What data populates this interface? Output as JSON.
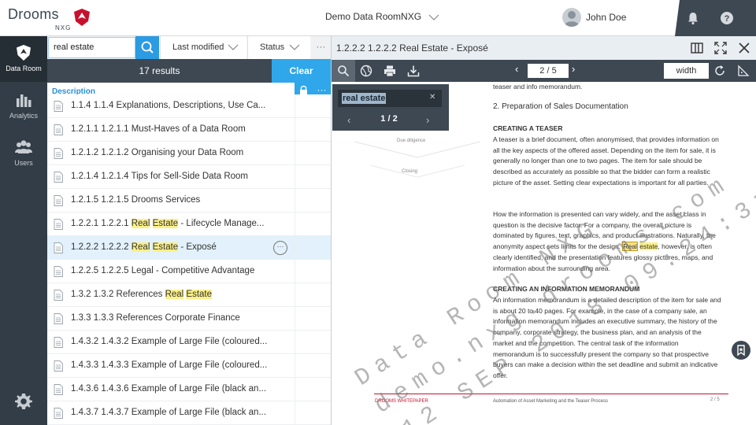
{
  "header": {
    "logo_text": "Drooms",
    "logo_sub": "NXG",
    "dataroom_name": "Demo Data RoomNXG",
    "user_name": "John Doe"
  },
  "nav": {
    "items": [
      {
        "label": "Data Room",
        "icon": "shield-icon",
        "active": true
      },
      {
        "label": "Analytics",
        "icon": "bar-chart-icon",
        "active": false
      },
      {
        "label": "Users",
        "icon": "users-icon",
        "active": false
      }
    ]
  },
  "search": {
    "query": "real estate",
    "filter_modified": "Last modified",
    "filter_status": "Status",
    "more": "···"
  },
  "results": {
    "count_text": "17 results",
    "clear_label": "Clear"
  },
  "list": {
    "column_description": "Description",
    "more": "···",
    "rows": [
      {
        "pre": "1.1.4 1.1.4 Explanations, Descriptions, Use Ca...",
        "h1": "",
        "mid": "",
        "h2": "",
        "post": "",
        "selected": false
      },
      {
        "pre": "1.2.1.1 1.2.1.1 Must-Haves of a Data Room",
        "h1": "",
        "mid": "",
        "h2": "",
        "post": "",
        "selected": false
      },
      {
        "pre": "1.2.1.2 1.2.1.2 Organising your Data Room",
        "h1": "",
        "mid": "",
        "h2": "",
        "post": "",
        "selected": false
      },
      {
        "pre": "1.2.1.4 1.2.1.4 Tips for Sell-Side Data Room",
        "h1": "",
        "mid": "",
        "h2": "",
        "post": "",
        "selected": false
      },
      {
        "pre": "1.2.1.5 1.2.1.5 Drooms Services",
        "h1": "",
        "mid": "",
        "h2": "",
        "post": "",
        "selected": false
      },
      {
        "pre": "1.2.2.1 1.2.2.1 ",
        "h1": "Real",
        "mid": " ",
        "h2": "Estate",
        "post": " - Lifecycle Manage...",
        "selected": false
      },
      {
        "pre": "1.2.2.2 1.2.2.2 ",
        "h1": "Real",
        "mid": " ",
        "h2": "Estate",
        "post": " - Exposé",
        "selected": true
      },
      {
        "pre": "1.2.2.5 1.2.2.5 Legal - Competitive Advantage",
        "h1": "",
        "mid": "",
        "h2": "",
        "post": "",
        "selected": false
      },
      {
        "pre": "1.3.2 1.3.2 References ",
        "h1": "Real",
        "mid": " ",
        "h2": "Estate",
        "post": "",
        "selected": false
      },
      {
        "pre": "1.3.3 1.3.3 References Corporate Finance",
        "h1": "",
        "mid": "",
        "h2": "",
        "post": "",
        "selected": false
      },
      {
        "pre": "1.4.3.2 1.4.3.2 Example of Large File (coloured...",
        "h1": "",
        "mid": "",
        "h2": "",
        "post": "",
        "selected": false
      },
      {
        "pre": "1.4.3.3 1.4.3.3 Example of Large File (coloured...",
        "h1": "",
        "mid": "",
        "h2": "",
        "post": "",
        "selected": false
      },
      {
        "pre": "1.4.3.6 1.4.3.6 Example of Large File (black an...",
        "h1": "",
        "mid": "",
        "h2": "",
        "post": "",
        "selected": false
      },
      {
        "pre": "1.4.3.7 1.4.3.7 Example of Large File (black an...",
        "h1": "",
        "mid": "",
        "h2": "",
        "post": "",
        "selected": false
      }
    ]
  },
  "viewer": {
    "title": "1.2.2.2 1.2.2.2 Real Estate - Exposé",
    "page_input": "2 / 5",
    "zoom_mode": "width",
    "find": {
      "query": "real estate",
      "count": "1 / 2"
    },
    "doc": {
      "top_line": "teaser and info memorandum.",
      "section": "2. Preparation of Sales Documentation",
      "h_teaser": "CREATING A TEASER",
      "p_teaser": "A teaser is a brief document, often anonymised, that provides information on all the key aspects of the offered asset. Depending on the item for sale, it is generally no longer than one to two pages. The item for sale should be described as accurately as possible so that the bidder can form a realistic picture of the asset. Setting clear expectations is important for all parties.",
      "p_how_pre": "How the information is presented can vary widely, and the asset class in question is the decisive factor. For a company, the overall picture is dominated by figures, text, graphics, and product illustrations. Naturally, the anonymity aspect sets limits for the design. ",
      "p_how_h1": "Real",
      "p_how_h2": "estate",
      "p_how_post": ", however, is often clearly identified, and the presentation features glossy pictures, maps, and information about the surrounding area.",
      "h_memo": "CREATING AN INFORMATION MEMORANDUM",
      "p_memo": "An information memorandum is a detailed description of the item for sale and is about 20 to 40 pages. For example, in the case of a company sale, an information memorandum includes an executive summary, the history of the company, corporate strategy, the business plan, and an analysis of the market and the competition. The central task of the information memorandum is to successfully present the company so that prospective buyers can make a decision within the set deadline and submit an indicative offer.",
      "diagram_label_1": "Due diligence",
      "diagram_label_2": "Closing",
      "footer_left": "DROOMS WHITEPAPER",
      "footer_mid": "Automation of Asset Marketing and the Teaser Process",
      "footer_right": "2 / 5",
      "watermark_1": "Data Room NXG",
      "watermark_2": "demo.nxg.drooms.com",
      "watermark_3": "12 SEP 2018 09:24:31"
    }
  },
  "colors": {
    "accent": "#2fa7ea",
    "dark_nav": "#333d47",
    "highlight": "#fbf089"
  }
}
